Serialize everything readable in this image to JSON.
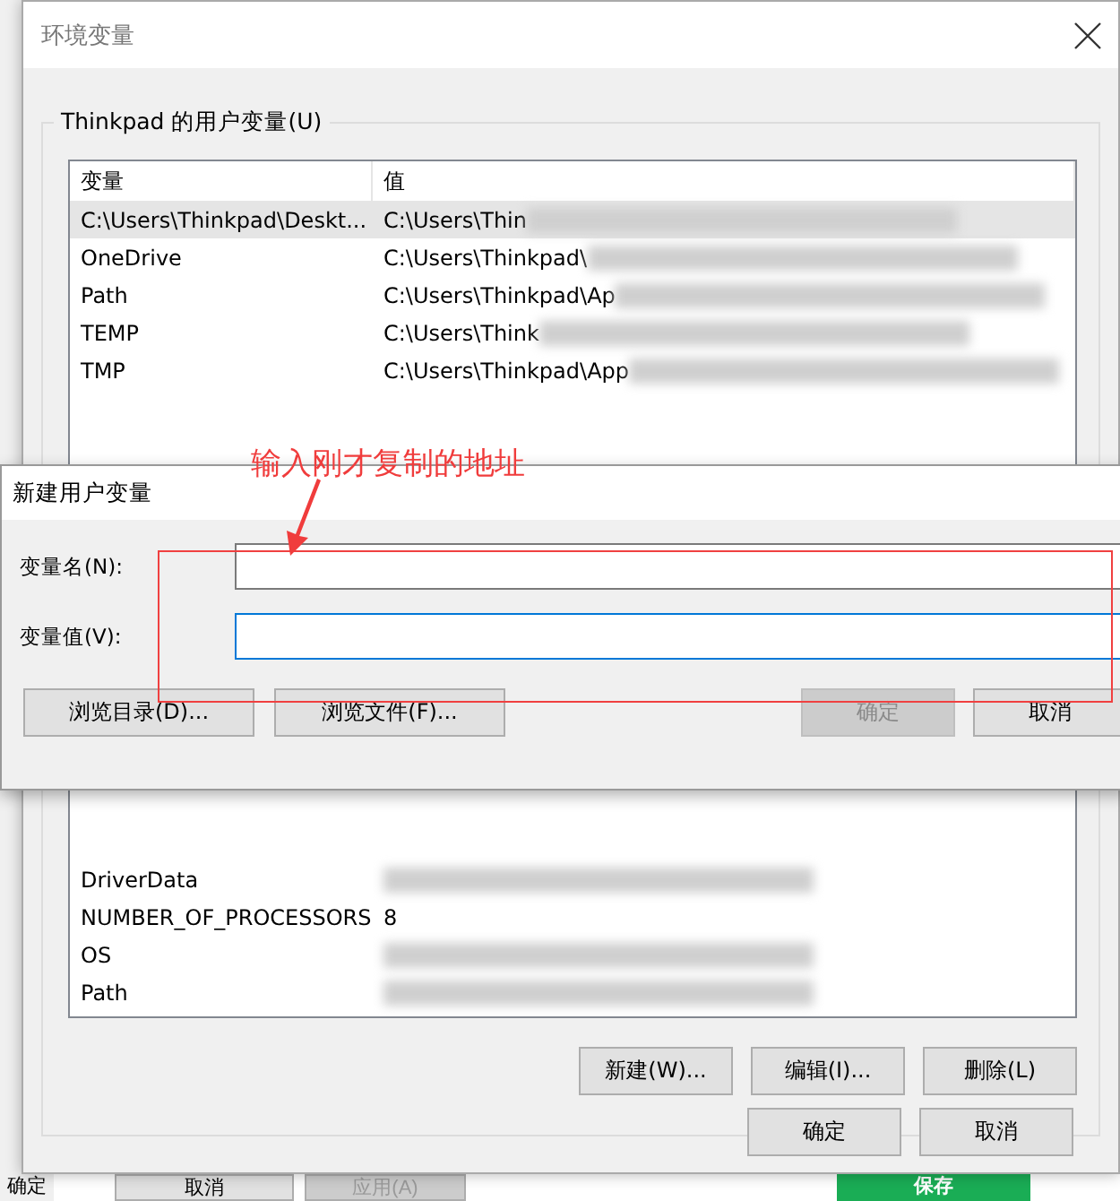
{
  "background_app": {
    "buttons": [
      {
        "label": "确定",
        "primary": false,
        "disabled": false
      },
      {
        "label": "取消",
        "primary": false,
        "disabled": false
      },
      {
        "label": "应用(A)",
        "primary": false,
        "disabled": true
      },
      {
        "label": "保存",
        "primary": true,
        "disabled": false
      }
    ]
  },
  "window": {
    "title": "环境变量",
    "user_variables": {
      "title": "Thinkpad 的用户变量(U)",
      "columns": [
        "变量",
        "值"
      ],
      "rows": [
        {
          "name": "C:\\Users\\Thinkpad\\Deskt...",
          "value": "C:\\Users\\Thin",
          "redacted": true,
          "selected": true
        },
        {
          "name": "OneDrive",
          "value": "C:\\Users\\Thinkpad\\",
          "redacted": true,
          "selected": false
        },
        {
          "name": "Path",
          "value": "C:\\Users\\Thinkpad\\Ap",
          "redacted": true,
          "selected": false
        },
        {
          "name": "TEMP",
          "value": "C:\\Users\\Think",
          "redacted": true,
          "selected": false
        },
        {
          "name": "TMP",
          "value": "C:\\Users\\Thinkpad\\App",
          "redacted": true,
          "selected": false
        }
      ]
    },
    "system_variables": {
      "rows": [
        {
          "name": "DriverData",
          "redacted": true,
          "selected": false
        },
        {
          "name": "NUMBER_OF_PROCESSORS",
          "value": "8",
          "redacted": false,
          "selected": false
        },
        {
          "name": "OS",
          "redacted": true,
          "selected": false
        },
        {
          "name": "Path",
          "redacted": true,
          "selected": false
        }
      ],
      "buttons": [
        {
          "label": "新建(W)..."
        },
        {
          "label": "编辑(I)..."
        },
        {
          "label": "删除(L)"
        }
      ]
    },
    "buttons": [
      {
        "label": "确定",
        "disabled": false
      },
      {
        "label": "取消",
        "disabled": false
      }
    ]
  },
  "new_variable_dialog": {
    "title": "新建用户变量",
    "fields": [
      {
        "label": "变量名(N):",
        "focused": false
      },
      {
        "label": "变量值(V):",
        "focused": true
      }
    ],
    "browse_buttons": [
      {
        "label": "浏览目录(D)..."
      },
      {
        "label": "浏览文件(F)..."
      }
    ],
    "buttons": [
      {
        "label": "确定",
        "disabled": true
      },
      {
        "label": "取消",
        "disabled": false
      }
    ]
  },
  "annotation": {
    "text": "输入刚才复制的地址"
  }
}
